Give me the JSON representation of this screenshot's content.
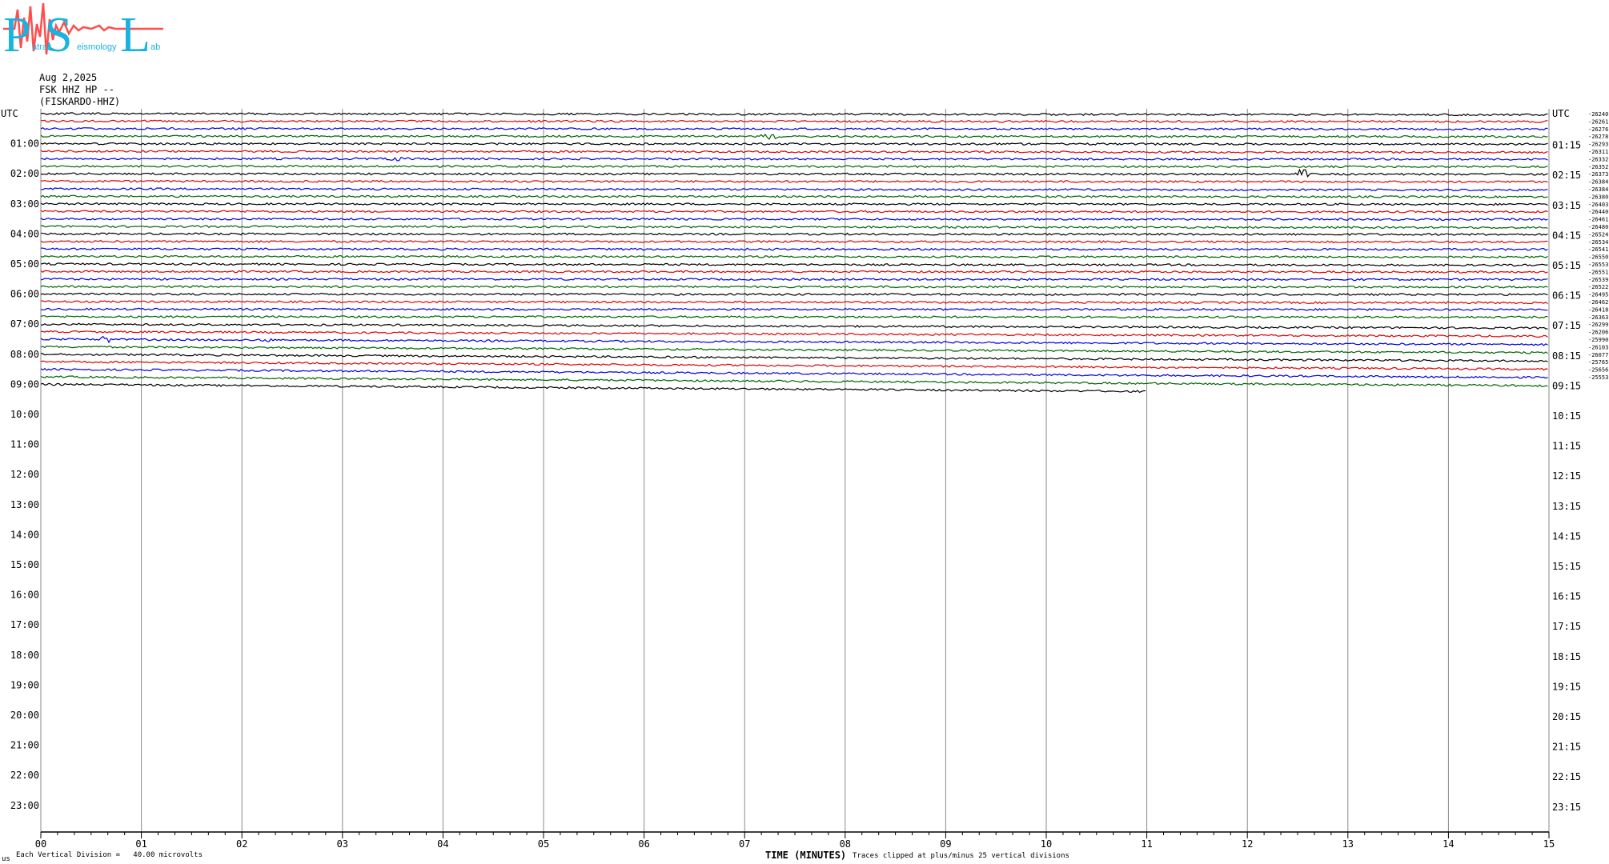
{
  "logo": {
    "letters": [
      "P",
      "S",
      "L"
    ],
    "small_text": [
      "atras",
      "eismology",
      "ab"
    ],
    "colors": {
      "letters": "#1ab2e0",
      "wiggle": "#ff4d4d"
    }
  },
  "header": {
    "date": "Aug 2,2025",
    "station": "FSK HHZ HP --",
    "channel_desc": "(FISKARDO-HHZ)"
  },
  "footer": {
    "left_mark": "us",
    "division_text": "Each Vertical Division =   40.00 microvolts",
    "clip_text": "Traces clipped at plus/minus 25 vertical divisions"
  },
  "chart_data": {
    "type": "line",
    "title": "",
    "xlabel": "TIME (MINUTES)",
    "ylabel": "UTC",
    "x_ticks": [
      "00",
      "01",
      "02",
      "03",
      "04",
      "05",
      "06",
      "07",
      "08",
      "09",
      "10",
      "11",
      "12",
      "13",
      "14",
      "15"
    ],
    "xlim": [
      0,
      15
    ],
    "grid": true,
    "left_hour_labels": [
      "UTC",
      "01:00",
      "02:00",
      "03:00",
      "04:00",
      "05:00",
      "06:00",
      "07:00",
      "08:00",
      "09:00",
      "10:00",
      "11:00",
      "12:00",
      "13:00",
      "14:00",
      "15:00",
      "16:00",
      "17:00",
      "18:00",
      "19:00",
      "20:00",
      "21:00",
      "22:00",
      "23:00"
    ],
    "right_hour_labels": [
      "UTC",
      "01:15",
      "02:15",
      "03:15",
      "04:15",
      "05:15",
      "06:15",
      "07:15",
      "08:15",
      "09:15",
      "10:15",
      "11:15",
      "12:15",
      "13:15",
      "14:15",
      "15:15",
      "16:15",
      "17:15",
      "18:15",
      "19:15",
      "20:15",
      "21:15",
      "22:15",
      "23:15"
    ],
    "trace_colors": [
      "#000000",
      "#e00000",
      "#0000e0",
      "#006400"
    ],
    "trace_count": 37,
    "last_trace_end_minute": 11.0,
    "trace_offsets": [
      "-26240",
      "-26261",
      "-26276",
      "-26278",
      "-26293",
      "-26311",
      "-26332",
      "-26352",
      "-26373",
      "-26384",
      "-26384",
      "-26380",
      "-26403",
      "-26440",
      "-26461",
      "-26480",
      "-26524",
      "-26534",
      "-26541",
      "-26550",
      "-26553",
      "-26551",
      "-26539",
      "-26522",
      "-26495",
      "-26462",
      "-26418",
      "-26363",
      "-26299",
      "-26206",
      "-25990",
      "-26103",
      "-26077",
      "-25765",
      "-25656",
      "-25553"
    ],
    "events": [
      {
        "row": 3,
        "minute": 7.25,
        "amp": 5
      },
      {
        "row": 6,
        "minute": 3.5,
        "amp": 4
      },
      {
        "row": 8,
        "minute": 12.55,
        "amp": 7
      },
      {
        "row": 30,
        "minute": 0.65,
        "amp": 5
      },
      {
        "row": 30,
        "minute": 2.25,
        "amp": 3
      }
    ]
  }
}
